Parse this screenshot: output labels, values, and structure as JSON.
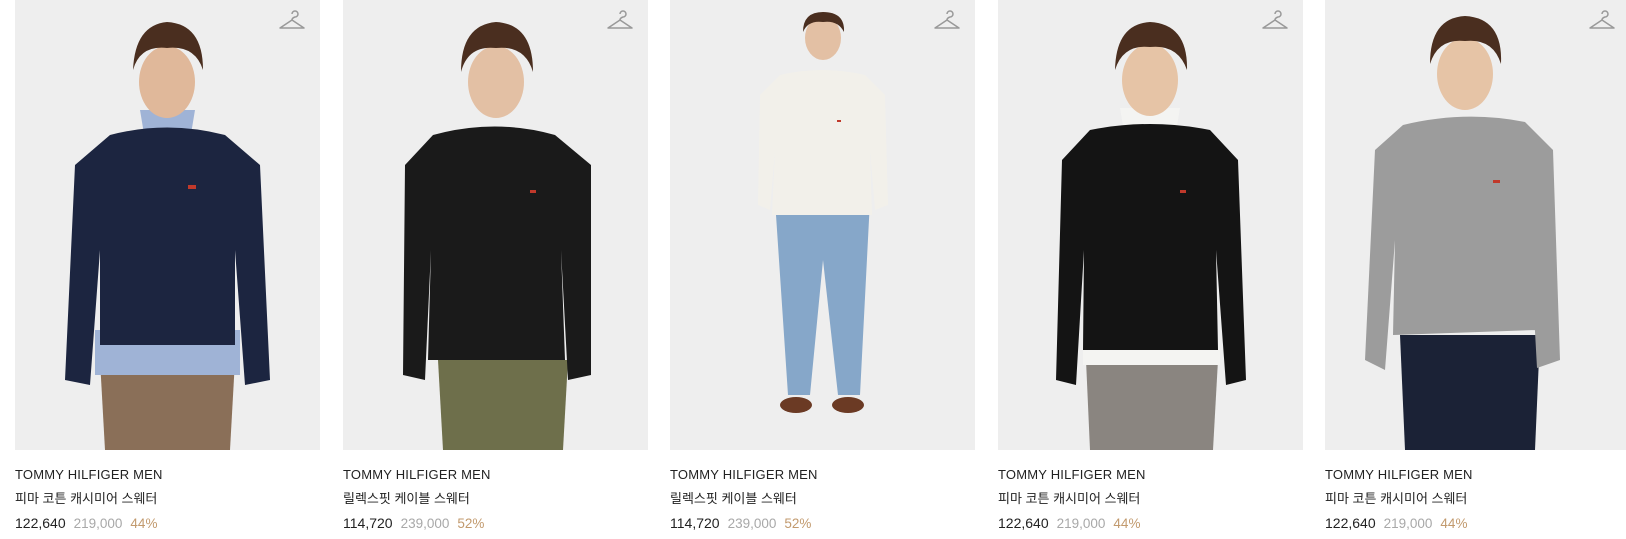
{
  "products": [
    {
      "brand": "TOMMY HILFIGER MEN",
      "name": "피마 코튼 캐시미어 스웨터",
      "price": "122,640",
      "original_price": "219,000",
      "discount": "44%",
      "colors": {
        "sweater": "#1c2540",
        "pants": "#8a6f58",
        "shirt": "#9fb3d6"
      }
    },
    {
      "brand": "TOMMY HILFIGER MEN",
      "name": "릴렉스핏 케이블 스웨터",
      "price": "114,720",
      "original_price": "239,000",
      "discount": "52%",
      "colors": {
        "sweater": "#1a1a1a",
        "pants": "#6e6f4b",
        "shirt": "#1a1a1a"
      }
    },
    {
      "brand": "TOMMY HILFIGER MEN",
      "name": "릴렉스핏 케이블 스웨터",
      "price": "114,720",
      "original_price": "239,000",
      "discount": "52%",
      "colors": {
        "sweater": "#f2f0ea",
        "pants": "#86a7c9",
        "shirt": "#f2f0ea"
      }
    },
    {
      "brand": "TOMMY HILFIGER MEN",
      "name": "피마 코튼 캐시미어 스웨터",
      "price": "122,640",
      "original_price": "219,000",
      "discount": "44%",
      "colors": {
        "sweater": "#141414",
        "pants": "#8a8580",
        "shirt": "#f4f4f2"
      }
    },
    {
      "brand": "TOMMY HILFIGER MEN",
      "name": "피마 코튼 캐시미어 스웨터",
      "price": "122,640",
      "original_price": "219,000",
      "discount": "44%",
      "colors": {
        "sweater": "#9c9c9c",
        "pants": "#1b2236",
        "shirt": "#9c9c9c"
      }
    }
  ],
  "icons": {
    "wishlist": "hanger-icon"
  },
  "colors": {
    "discount": "#c29a6e",
    "original_price": "#a8a8a8",
    "text": "#222222",
    "photo_bg": "#eeeeee"
  }
}
